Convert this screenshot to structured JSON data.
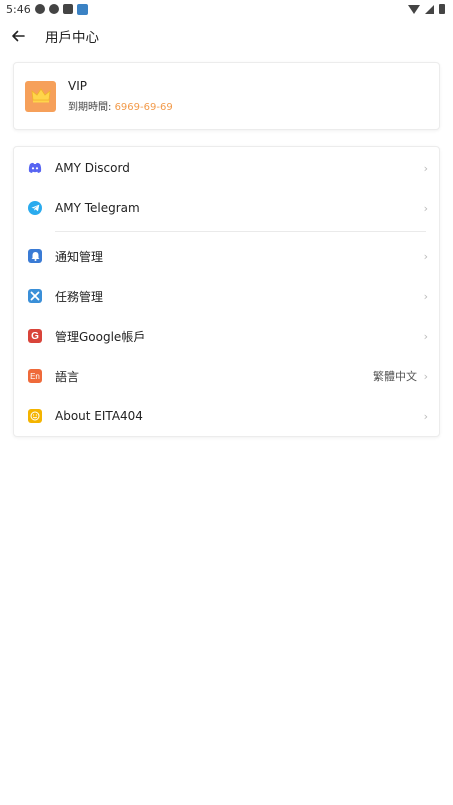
{
  "status_bar": {
    "time": "5:46"
  },
  "app_bar": {
    "back_icon": "arrow-left-icon",
    "title": "用戶中心"
  },
  "vip": {
    "title": "VIP",
    "expiry_label": "到期時間: ",
    "expiry_date": "6969-69-69",
    "avatar_icon": "crown-icon",
    "accent_color": "#f6a05a"
  },
  "menu": {
    "items": [
      {
        "label": "AMY Discord",
        "icon": "discord-icon",
        "color": "#5865F2",
        "value": ""
      },
      {
        "label": "AMY Telegram",
        "icon": "telegram-icon",
        "color": "#2AABEE",
        "value": ""
      },
      {
        "label": "通知管理",
        "icon": "bell-icon",
        "color": "#3a7bd5",
        "value": ""
      },
      {
        "label": "任務管理",
        "icon": "tools-icon",
        "color": "#3a8fd8",
        "value": ""
      },
      {
        "label": "管理Google帳戶",
        "icon": "google-icon",
        "color": "#d9443a",
        "value": ""
      },
      {
        "label": "語言",
        "icon": "language-icon",
        "color": "#ef6a3a",
        "value": "繁體中文"
      },
      {
        "label": "About EITA404",
        "icon": "smile-icon",
        "color": "#f4b400",
        "value": ""
      }
    ],
    "language_icon_text": "En"
  }
}
